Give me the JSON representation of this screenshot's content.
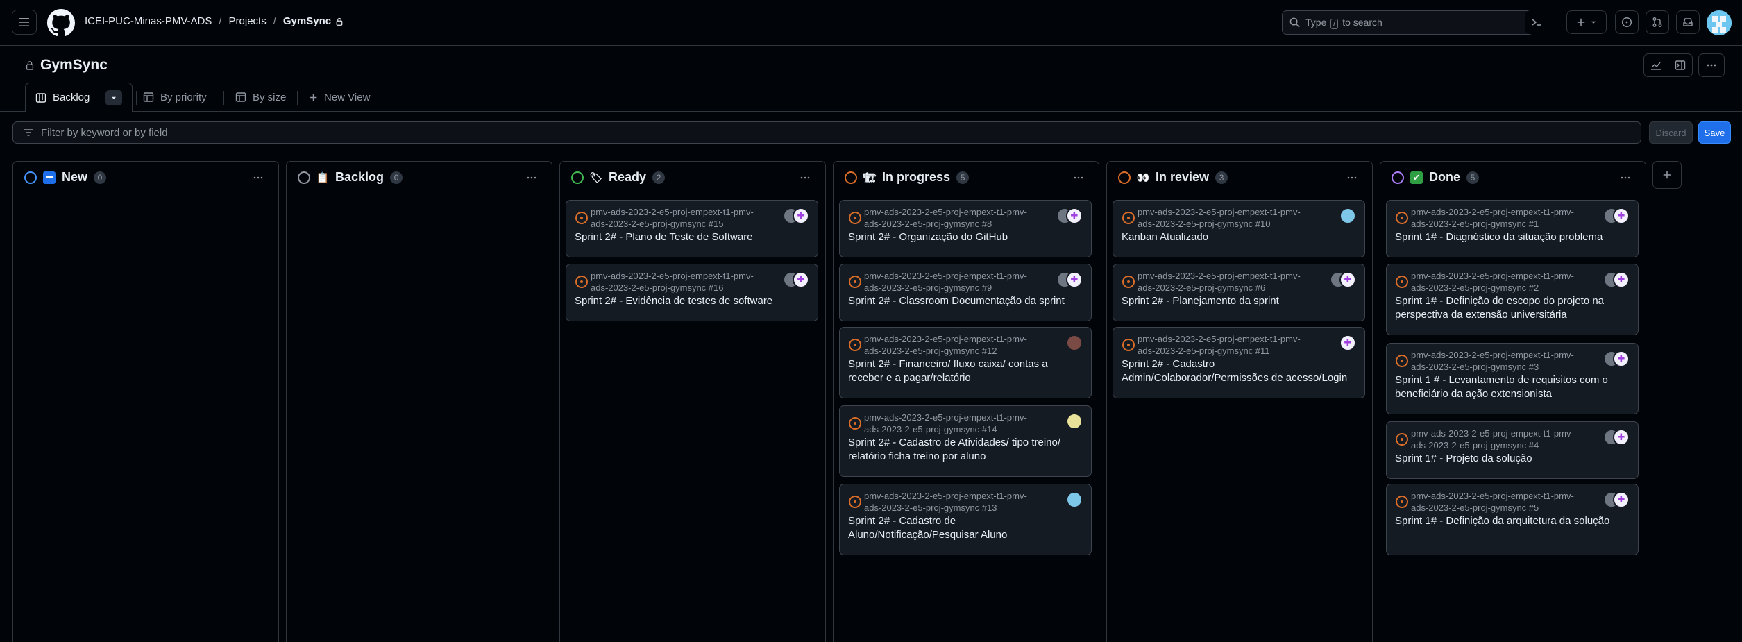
{
  "header": {
    "breadcrumb": [
      "ICEI-PUC-Minas-PMV-ADS",
      "Projects",
      "GymSync"
    ],
    "search_prefix": "Type",
    "search_key": "/",
    "search_suffix": "to search"
  },
  "project": {
    "title": "GymSync"
  },
  "tabs": [
    {
      "label": "Backlog",
      "active": true
    },
    {
      "label": "By priority"
    },
    {
      "label": "By size"
    },
    {
      "label": "New View"
    }
  ],
  "filter": {
    "placeholder": "Filter by keyword or by field",
    "discard_label": "Discard",
    "save_label": "Save"
  },
  "columns": [
    {
      "name": "New",
      "count": "0",
      "ring_color": "#4493f8",
      "icon": "blue-bar-icon",
      "cards": []
    },
    {
      "name": "Backlog",
      "count": "0",
      "ring_color": "#9198a1",
      "icon": "clipboard-icon",
      "cards": []
    },
    {
      "name": "Ready",
      "count": "2",
      "ring_color": "#3fb950",
      "icon": "label-tag-icon",
      "cards": [
        {
          "repo": "pmv-ads-2023-2-e5-proj-empext-t1-pmv-ads-2023-2-e5-proj-gymsync #15",
          "title": "Sprint 2# - Plano de Teste de Software"
        },
        {
          "repo": "pmv-ads-2023-2-e5-proj-empext-t1-pmv-ads-2023-2-e5-proj-gymsync #16",
          "title": "Sprint 2# - Evidência de testes de software"
        }
      ]
    },
    {
      "name": "In progress",
      "count": "5",
      "ring_color": "#db6d28",
      "icon": "construction-icon",
      "cards": [
        {
          "repo": "pmv-ads-2023-2-e5-proj-empext-t1-pmv-ads-2023-2-e5-proj-gymsync #8",
          "title": "Sprint 2# - Organização do GitHub"
        },
        {
          "repo": "pmv-ads-2023-2-e5-proj-empext-t1-pmv-ads-2023-2-e5-proj-gymsync #9",
          "title": "Sprint 2# - Classroom Documentação da sprint"
        },
        {
          "repo": "pmv-ads-2023-2-e5-proj-empext-t1-pmv-ads-2023-2-e5-proj-gymsync #12",
          "title": "Sprint 2# - Financeiro/ fluxo caixa/ contas a receber e a pagar/relatório"
        },
        {
          "repo": "pmv-ads-2023-2-e5-proj-empext-t1-pmv-ads-2023-2-e5-proj-gymsync #14",
          "title": "Sprint 2# - Cadastro de Atividades/ tipo treino/ relatório ficha treino por aluno"
        },
        {
          "repo": "pmv-ads-2023-2-e5-proj-empext-t1-pmv-ads-2023-2-e5-proj-gymsync #13",
          "title": "Sprint 2# - Cadastro de Aluno/Notificação/Pesquisar Aluno"
        }
      ]
    },
    {
      "name": "In review",
      "count": "3",
      "ring_color": "#db6d28",
      "icon": "eyes-icon",
      "cards": [
        {
          "repo": "pmv-ads-2023-2-e5-proj-empext-t1-pmv-ads-2023-2-e5-proj-gymsync #10",
          "title": "Kanban Atualizado"
        },
        {
          "repo": "pmv-ads-2023-2-e5-proj-empext-t1-pmv-ads-2023-2-e5-proj-gymsync #6",
          "title": "Sprint 2# - Planejamento da sprint"
        },
        {
          "repo": "pmv-ads-2023-2-e5-proj-empext-t1-pmv-ads-2023-2-e5-proj-gymsync #11",
          "title": "Sprint 2# - Cadastro Admin/Colaborador/Permissões de acesso/Login"
        }
      ]
    },
    {
      "name": "Done",
      "count": "5",
      "ring_color": "#ab7df8",
      "icon": "check-mark-icon",
      "cards": [
        {
          "repo": "pmv-ads-2023-2-e5-proj-empext-t1-pmv-ads-2023-2-e5-proj-gymsync #1",
          "title": "Sprint 1# - Diagnóstico da situação problema"
        },
        {
          "repo": "pmv-ads-2023-2-e5-proj-empext-t1-pmv-ads-2023-2-e5-proj-gymsync #2",
          "title": "Sprint 1# - Definição do escopo do projeto na perspectiva da extensão universitária"
        },
        {
          "repo": "pmv-ads-2023-2-e5-proj-empext-t1-pmv-ads-2023-2-e5-proj-gymsync #3",
          "title": "Sprint 1 # - Levantamento de requisitos com o beneficiário da ação extensionista"
        },
        {
          "repo": "pmv-ads-2023-2-e5-proj-empext-t1-pmv-ads-2023-2-e5-proj-gymsync #4",
          "title": "Sprint 1# - Projeto da solução"
        },
        {
          "repo": "pmv-ads-2023-2-e5-proj-empext-t1-pmv-ads-2023-2-e5-proj-gymsync #5",
          "title": "Sprint 1# - Definição da arquitetura da solução"
        }
      ]
    }
  ]
}
